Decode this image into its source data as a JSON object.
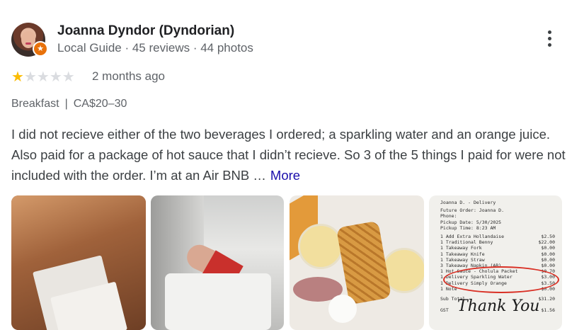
{
  "reviewer": {
    "name": "Joanna Dyndor (Dyndorian)",
    "meta": "Local Guide · 45 reviews · 44 photos"
  },
  "rating": {
    "stars": 1,
    "max": 5,
    "time": "2 months ago"
  },
  "tags": {
    "meal": "Breakfast",
    "separator": "|",
    "price": "CA$20–30"
  },
  "review": {
    "text": "I did not recieve either of the two beverages I ordered; a sparkling water and an orange juice. Also paid for a package of hot sauce that I didn’t recieve. So 3 of the 5 things I paid for were not included with the order. I’m at an Air BNB …",
    "more_label": "More"
  },
  "icons": {
    "menu": "more-vert-icon",
    "badge": "local-guide-star-icon",
    "star": "star-icon"
  },
  "colors": {
    "star_on": "#fbbc04",
    "star_off": "#dadce0",
    "link": "#1a0dab",
    "badge": "#e8710a"
  },
  "receipt": {
    "lines": [
      {
        "l": "Joanna D. - Delivery",
        "r": ""
      },
      {
        "l": "Future Order: Joanna D.",
        "r": ""
      },
      {
        "l": "Phone:",
        "r": ""
      },
      {
        "l": "Pickup Date: 5/30/2025",
        "r": ""
      },
      {
        "l": "Pickup Time: 8:23 AM",
        "r": ""
      },
      {
        "l": "1 Add Extra Hollandaise",
        "r": "$2.50"
      },
      {
        "l": "1 Traditional Benny",
        "r": "$22.00"
      },
      {
        "l": "1 Takeaway Fork",
        "r": "$0.00"
      },
      {
        "l": "1 Takeaway Knife",
        "r": "$0.00"
      },
      {
        "l": "1 Takeaway Straw",
        "r": "$0.00"
      },
      {
        "l": "3 Takeaway Napkin (AB)",
        "r": "$0.00"
      },
      {
        "l": "1 Hot Sauce - Cholula Packet",
        "r": "$0.70"
      },
      {
        "l": "1 Delivery Sparkling Water",
        "r": "$3.00"
      },
      {
        "l": "1 Delivery Simply Orange",
        "r": "$3.50"
      },
      {
        "l": "1 Note",
        "r": "$0.00"
      }
    ],
    "subtotal_label": "Sub Total",
    "subtotal": "$31.20",
    "gst_label": "GST",
    "gst": "$1.56",
    "thanks": "Thank You"
  }
}
